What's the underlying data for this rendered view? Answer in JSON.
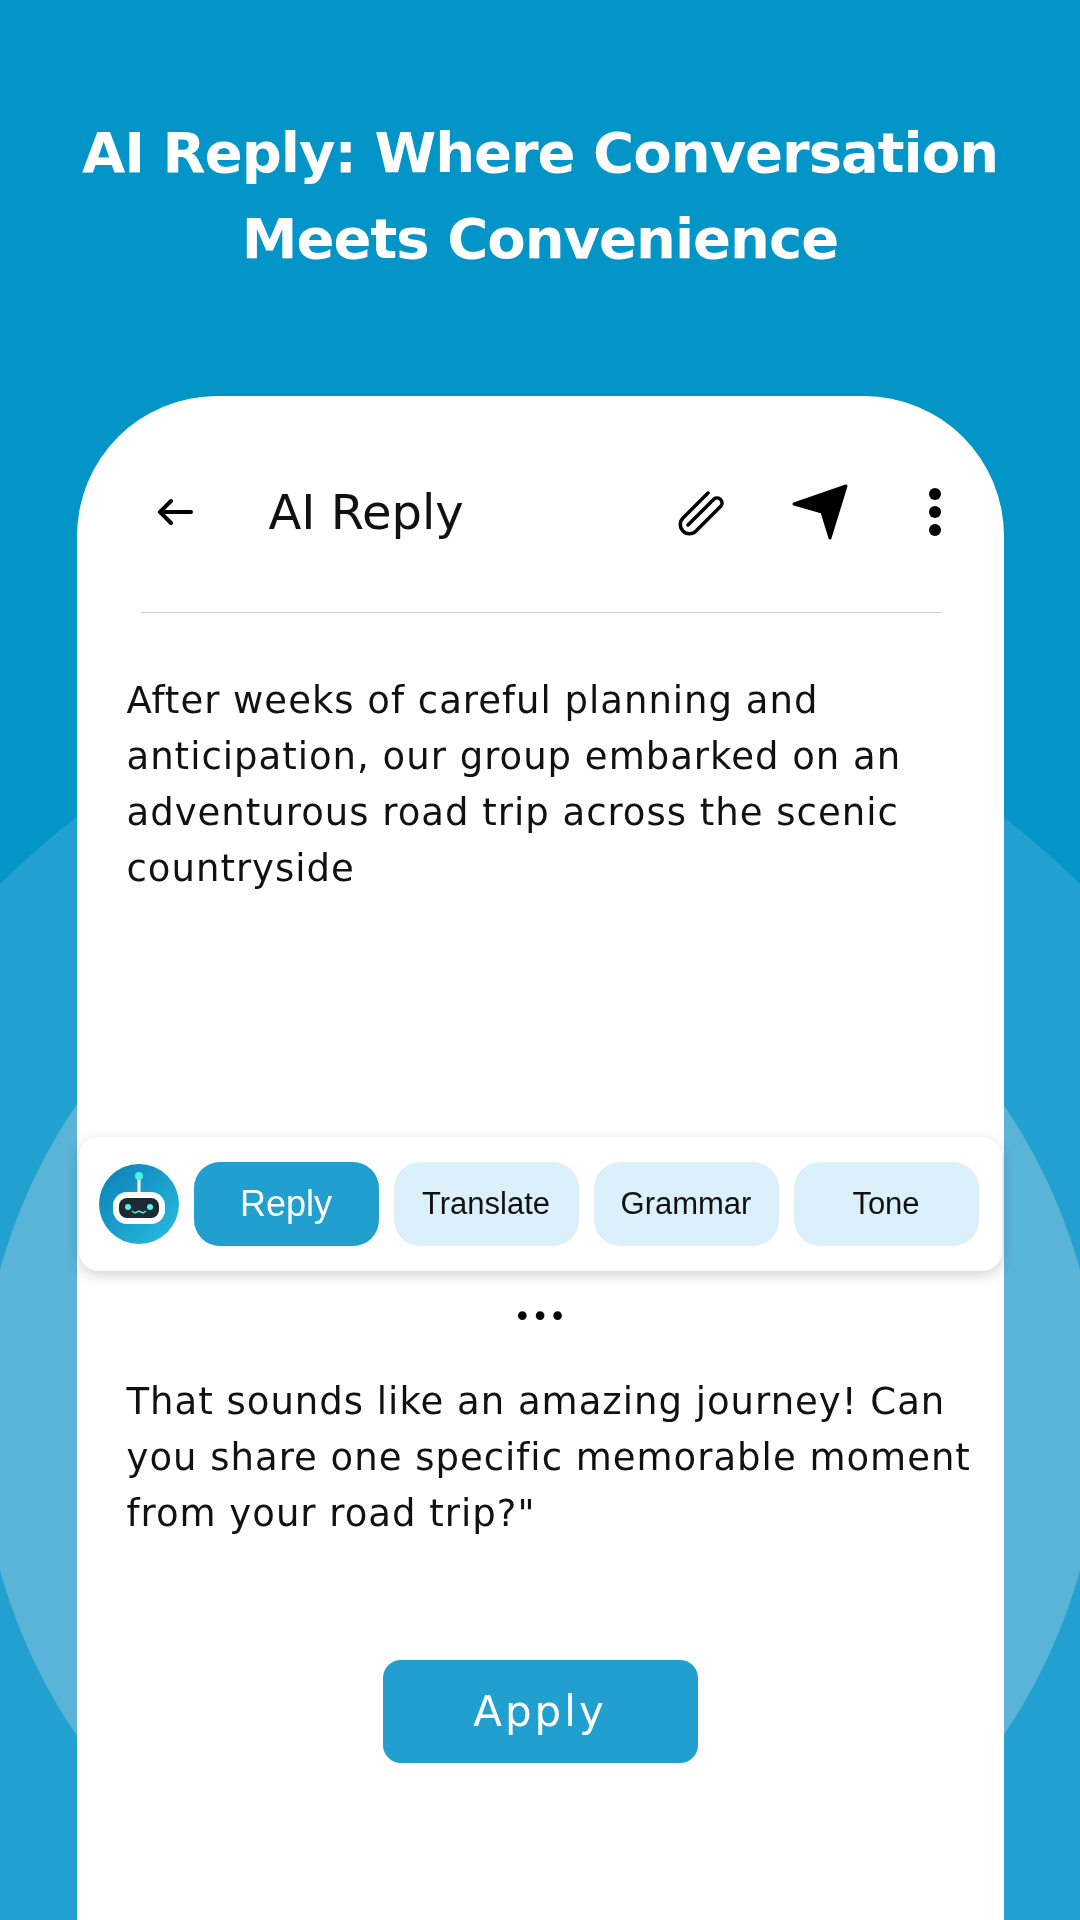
{
  "headline": "AI Reply: Where Conversation Meets Convenience",
  "app_bar": {
    "title": "AI Reply"
  },
  "input_text": "After weeks of careful planning and anticipation, our group embarked on an adventurous road trip across the scenic countryside",
  "tools": [
    {
      "label": "Reply",
      "selected": true
    },
    {
      "label": "Translate",
      "selected": false
    },
    {
      "label": "Grammar",
      "selected": false
    },
    {
      "label": "Tone",
      "selected": false
    }
  ],
  "more": "•••",
  "reply_text": "That sounds like an amazing journey! Can you share one specific memorable moment from your road trip?\"",
  "apply_button": "Apply"
}
